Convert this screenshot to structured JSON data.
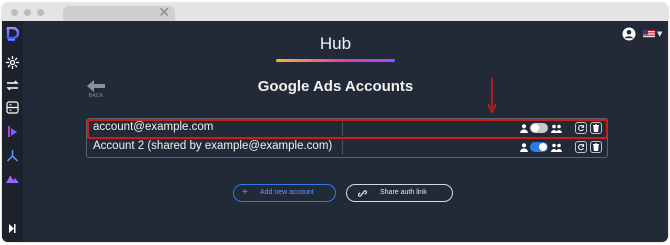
{
  "app": {
    "title": "Hub"
  },
  "page": {
    "title": "Google Ads Accounts",
    "back_label": "BACK"
  },
  "accounts": [
    {
      "label": "account@example.com",
      "shared": false,
      "highlighted": true
    },
    {
      "label": "Account 2 (shared by example@example.com)",
      "shared": true,
      "highlighted": false
    }
  ],
  "actions": {
    "add_label": "Add new account",
    "share_label": "Share auth link"
  },
  "header": {
    "locale_flag": "us-flag-icon"
  },
  "colors": {
    "background": "#232a37",
    "sidebar": "#1c212b",
    "accent_blue": "#2f7ae5",
    "highlight_red": "#d11a1a",
    "toggle_off": "#c9c9c9",
    "toggle_on": "#2f7ae5"
  }
}
